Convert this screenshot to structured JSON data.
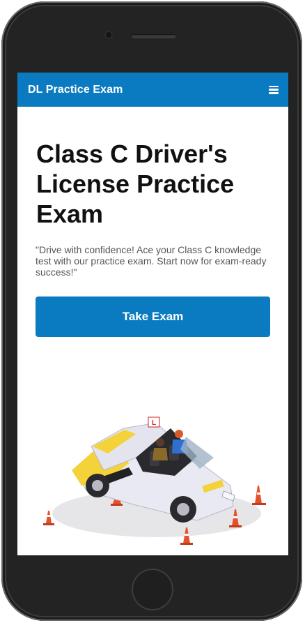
{
  "navbar": {
    "brand": "DL Practice Exam",
    "menu_icon": "hamburger-menu-icon"
  },
  "hero": {
    "title": "Class C Driver's License Practice Exam",
    "tagline": "\"Drive with confidence! Ace your Class C knowledge test with our practice exam. Start now for exam-ready success!\"",
    "cta_label": "Take Exam"
  },
  "illustration": {
    "car_body_color": "#e9e9f3",
    "car_accent_color": "#f4d23a",
    "cone_color": "#e8502a"
  },
  "colors": {
    "primary": "#0b7bc1",
    "text": "#111111",
    "muted": "#555555"
  }
}
